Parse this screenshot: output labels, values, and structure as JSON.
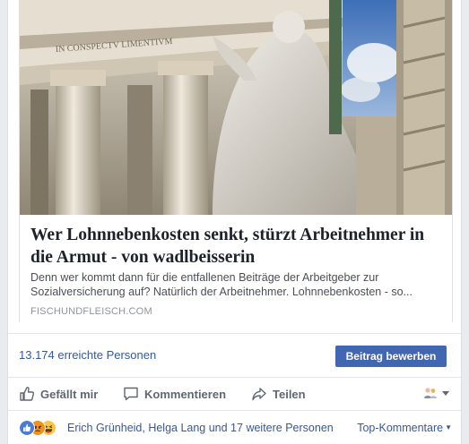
{
  "link_preview": {
    "image_alt": "Stone statue with columns of a baroque church under blue sky",
    "title": "Wer Lohnnebenkosten senkt, stürzt Arbeitnehmer in die Armut - von wadlbeisserin",
    "description": "Denn wer kommt dann für die entfallenen Beiträge der Arbeitgeber zur Sozialversicherung auf? Natürlich der Arbeitnehmer. Lohnnebenkosten - so...",
    "domain": "FISCHUNDFLEISCH.COM"
  },
  "insights": {
    "reach_text": "13.174 erreichte Personen",
    "boost_label": "Beitrag bewerben"
  },
  "actions": {
    "like_label": "Gefällt mir",
    "comment_label": "Kommentieren",
    "share_label": "Teilen"
  },
  "reactions": {
    "names_text": "Erich Grünheid, Helga Lang und 17 weitere Personen",
    "sort_label": "Top-Kommentare",
    "icons": [
      "like-reaction-icon",
      "angry-reaction-icon",
      "haha-reaction-icon"
    ]
  },
  "colors": {
    "link": "#365899",
    "button": "#4267b2",
    "title": "#1d2129"
  }
}
